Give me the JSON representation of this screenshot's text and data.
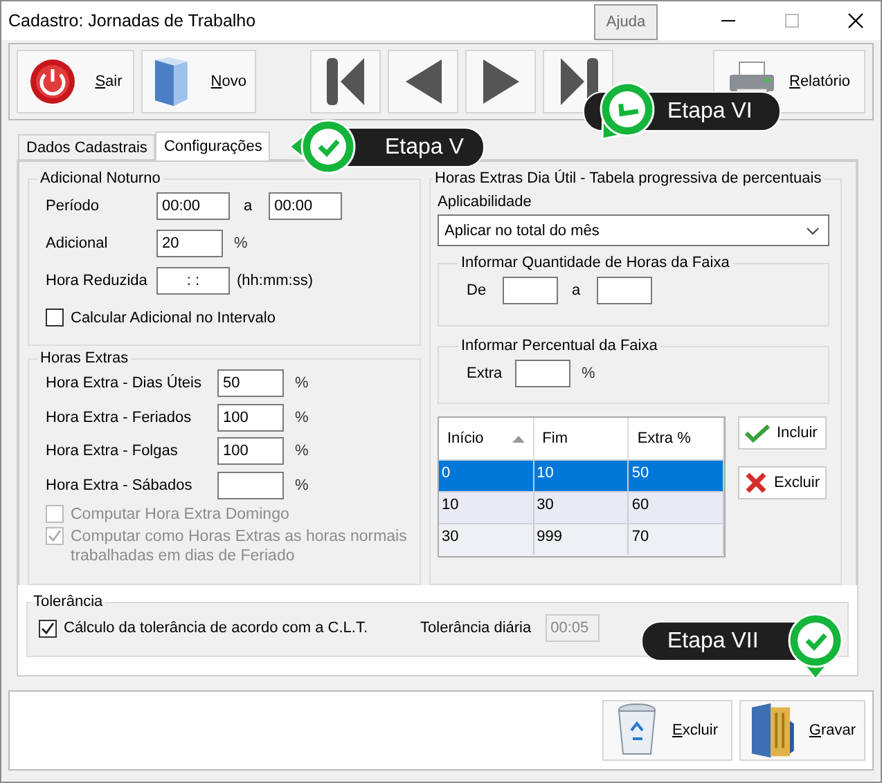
{
  "window": {
    "title": "Cadastro: Jornadas de Trabalho",
    "help_button": "Ajuda"
  },
  "toolbar": [
    {
      "kind": "exit",
      "label": "Sair"
    },
    {
      "kind": "new",
      "label": "Novo"
    },
    {
      "kind": "first"
    },
    {
      "kind": "prev"
    },
    {
      "kind": "next"
    },
    {
      "kind": "last"
    },
    {
      "kind": "print",
      "label": "Relatório"
    }
  ],
  "tabs": [
    {
      "label": "Dados Cadastrais",
      "selected": false
    },
    {
      "label": "Configurações",
      "selected": true
    }
  ],
  "adicional_noturno": {
    "title": "Adicional Noturno",
    "periodo_label": "Período",
    "periodo_from": "00:00",
    "periodo_sep": "a",
    "periodo_to": "00:00",
    "adicional_label": "Adicional",
    "adicional_value": "20",
    "adicional_unit": "%",
    "hora_reduzida_label": "Hora Reduzida",
    "hora_reduzida_value": ": :",
    "hora_reduzida_hint": "(hh:mm:ss)",
    "checkbox": {
      "label": "Calcular Adicional no Intervalo",
      "checked": false
    }
  },
  "horas_extras": {
    "title": "Horas Extras",
    "rows": [
      {
        "label": "Hora Extra - Dias Úteis",
        "value": "50",
        "unit": "%"
      },
      {
        "label": "Hora Extra - Feriados",
        "value": "100",
        "unit": "%"
      },
      {
        "label": "Hora Extra - Folgas",
        "value": "100",
        "unit": "%"
      },
      {
        "label": "Hora Extra - Sábados",
        "unit": "%"
      }
    ],
    "options": [
      {
        "label": "Computar Hora Extra Domingo",
        "checked": false,
        "disabled": true
      },
      {
        "label": "Computar como Horas Extras as horas normais trabalhadas em dias de Feriado",
        "checked": true,
        "disabled": true
      }
    ]
  },
  "progressiva": {
    "title": "Horas Extras Dia Útil - Tabela progressiva de percentuais",
    "aplicabilidade_label": "Aplicabilidade",
    "aplicabilidade_value": "Aplicar no total do mês",
    "faixa_horas": {
      "title": "Informar Quantidade de Horas da Faixa",
      "de_label": "De",
      "ate_label": "a"
    },
    "faixa_percentual": {
      "title": "Informar Percentual da Faixa",
      "extra_label": "Extra",
      "unit": "%"
    },
    "table": {
      "columns": [
        {
          "label": "Início",
          "sorted": true
        },
        {
          "label": "Fim",
          "sorted": false
        },
        {
          "label": "Extra %",
          "sorted": false
        }
      ],
      "rows": [
        {
          "cells": [
            "0",
            "10",
            "50"
          ],
          "selected": true
        },
        {
          "cells": [
            "10",
            "30",
            "60"
          ],
          "selected": false
        },
        {
          "cells": [
            "30",
            "999",
            "70"
          ],
          "selected": false
        }
      ]
    },
    "buttons": [
      {
        "kind": "add",
        "label": "Incluir"
      },
      {
        "kind": "delete",
        "label": "Excluir"
      }
    ]
  },
  "tolerancia": {
    "title": "Tolerância",
    "checkbox": {
      "label": "Cálculo da tolerância de acordo com a C.L.T.",
      "checked": true
    },
    "diaria_label": "Tolerância diária",
    "diaria_value": "00:05",
    "diaria_disabled": true
  },
  "footer_buttons": [
    {
      "kind": "delete",
      "label": "Excluir"
    },
    {
      "kind": "save",
      "label": "Gravar"
    }
  ],
  "callouts": [
    {
      "label": "Etapa V"
    },
    {
      "label": "Etapa VI"
    },
    {
      "label": "Etapa VII"
    }
  ]
}
